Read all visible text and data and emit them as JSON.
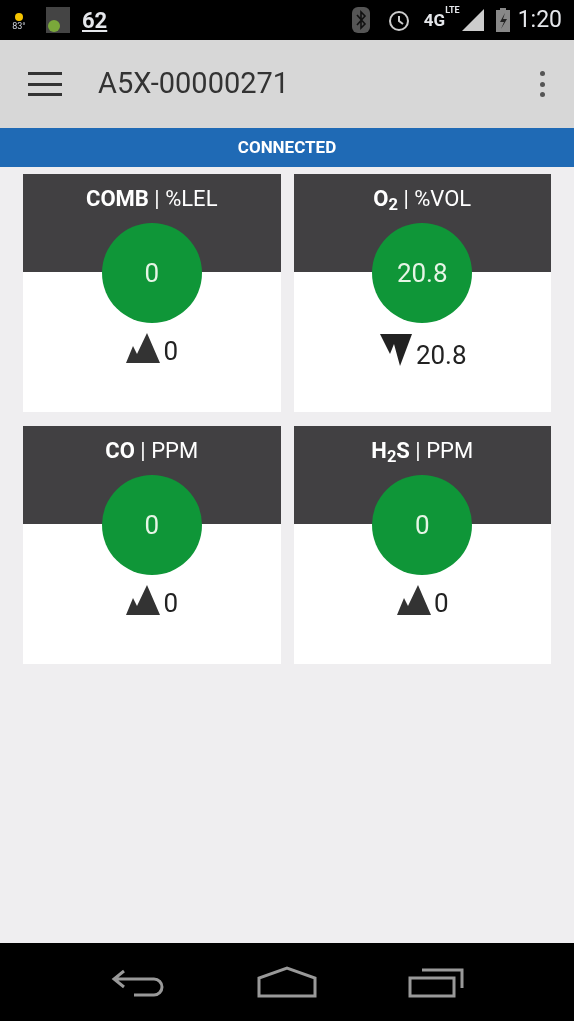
{
  "status_bar": {
    "temperature": "83°",
    "notification_count": "62",
    "network": "4G",
    "network_sub": "LTE",
    "time": "1:20"
  },
  "toolbar": {
    "title": "A5X-00000271"
  },
  "connection": {
    "label": "CONNECTED"
  },
  "sensors": [
    {
      "title": "**COMB** | %LEL",
      "reading": "0",
      "kind": "max",
      "peak": "0"
    },
    {
      "title": "**O$_{2}$** | %VOL",
      "reading": "20.8",
      "kind": "min",
      "peak": "20.8"
    },
    {
      "title": "**CO** | PPM",
      "reading": "0",
      "kind": "max",
      "peak": "0"
    },
    {
      "title": "**H$_{2}$S** | PPM",
      "reading": "0",
      "kind": "max",
      "peak": "0"
    }
  ]
}
